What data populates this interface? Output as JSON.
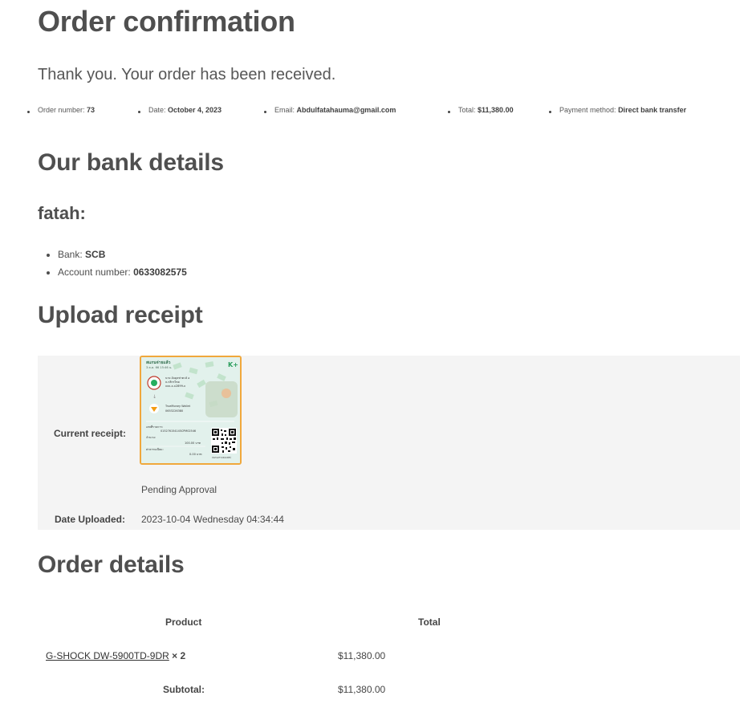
{
  "page_title": "Order confirmation",
  "thank_you": "Thank you. Your order has been received.",
  "overview": {
    "order_number_label": "Order number:",
    "order_number": "73",
    "date_label": "Date:",
    "date": "October 4, 2023",
    "email_label": "Email:",
    "email": "Abdulfatahauma@gmail.com",
    "total_label": "Total:",
    "total": "$11,380.00",
    "payment_label": "Payment method:",
    "payment": "Direct bank transfer"
  },
  "bank": {
    "heading": "Our bank details",
    "account_name": "fatah:",
    "bank_label": "Bank:",
    "bank_value": "SCB",
    "account_label": "Account number:",
    "account_value": "0633082575"
  },
  "upload": {
    "heading": "Upload receipt",
    "current_label": "Current receipt:",
    "status": "Pending Approval",
    "date_label": "Date Uploaded:",
    "date_value": "2023-10-04 Wednesday 04:34:44",
    "receipt_image": {
      "title": "สแกนจ่ายแล้ว",
      "datetime": "3 ต.ค. 66 15:46 น.",
      "brand": "K+",
      "sender_name": "นาย อับดุลฟาตะฮ์ อ",
      "sender_bank": "ธ.กสิกรไทย",
      "sender_acct": "xxx-x-x2899-x",
      "recipient_name": "TrueMoney Wallet",
      "recipient_acct": "0653226380",
      "ref_label": "เลขที่รายการ:",
      "ref_value": "015276154145CPM02546",
      "amount_label": "จำนวน:",
      "amount_value": "100.00 บาท",
      "fee_label": "ค่าธรรมเนียม:",
      "fee_value": "0.00 บาท",
      "qr_caption": "สแกนตรวจสอบสลิป",
      "accent_color": "#2a9d5c"
    }
  },
  "order": {
    "heading": "Order details",
    "col_product": "Product",
    "col_total": "Total",
    "item_name": "G-SHOCK DW-5900TD-9DR",
    "item_qty": "× 2",
    "item_total": "$11,380.00",
    "subtotal_label": "Subtotal:",
    "subtotal_value": "$11,380.00"
  }
}
